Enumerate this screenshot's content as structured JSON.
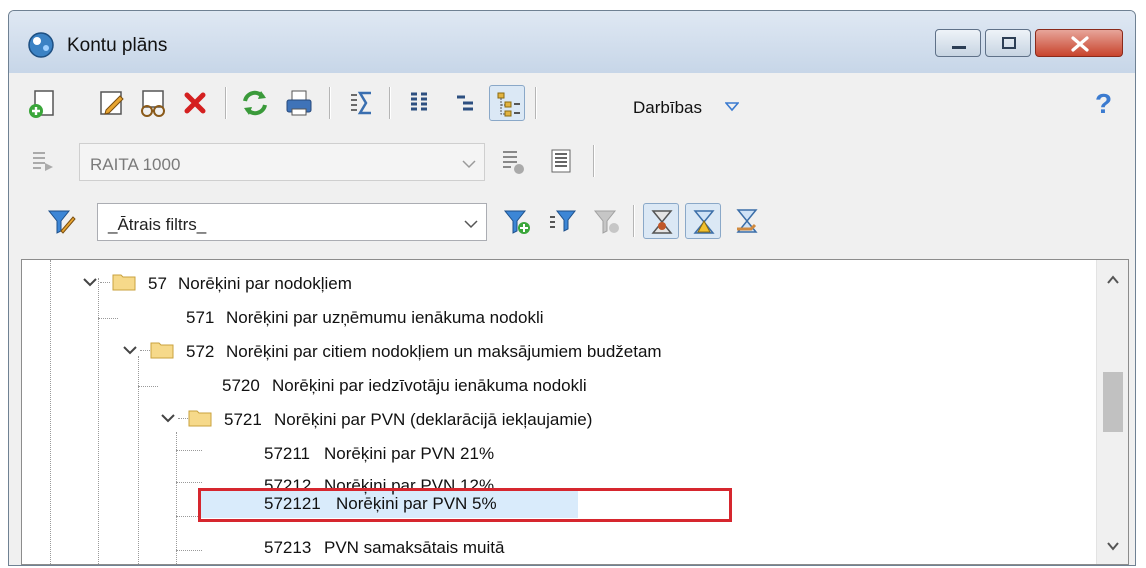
{
  "window": {
    "title": "Kontu plāns"
  },
  "toolbar": {
    "actions_label": "Darbības",
    "help_symbol": "?"
  },
  "view_select": {
    "value": "RAITA 1000"
  },
  "filter": {
    "value": "_Ātrais filtrs_"
  },
  "tree": {
    "rows": [
      {
        "num": "57",
        "name": "Norēķini par nodokļiem"
      },
      {
        "num": "571",
        "name": "Norēķini par uzņēmumu ienākuma nodokli"
      },
      {
        "num": "572",
        "name": "Norēķini par citiem nodokļiem un maksājumiem budžetam"
      },
      {
        "num": "5720",
        "name": "Norēķini par iedzīvotāju ienākuma nodokli"
      },
      {
        "num": "5721",
        "name": "Norēķini par PVN (deklarācijā iekļaujamie)"
      },
      {
        "num": "57211",
        "name": "Norēķini par PVN 21%"
      },
      {
        "num": "57212",
        "name": "Norēķini par PVN 12%"
      },
      {
        "num": "572121",
        "name": "Norēķini par PVN 5%"
      },
      {
        "num": "57213",
        "name": "PVN samaksātais muitā"
      }
    ]
  }
}
